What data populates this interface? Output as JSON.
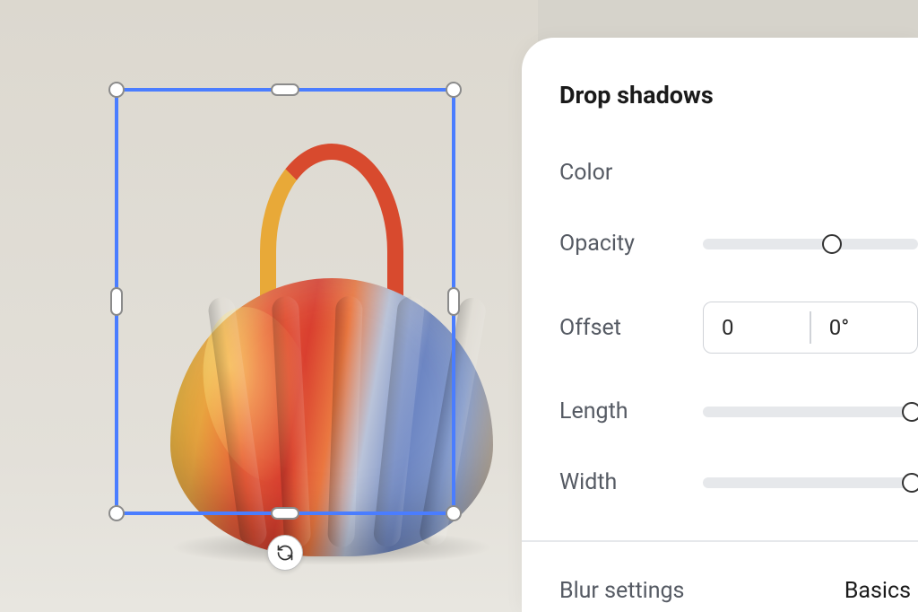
{
  "panel": {
    "title": "Drop shadows",
    "controls": {
      "color": {
        "label": "Color"
      },
      "opacity": {
        "label": "Opacity",
        "value_pct": 60
      },
      "offset": {
        "label": "Offset",
        "distance": "0",
        "angle": "0°"
      },
      "length": {
        "label": "Length",
        "value_pct": 100
      },
      "width": {
        "label": "Width",
        "value_pct": 100
      }
    },
    "blur": {
      "label": "Blur settings",
      "mode": "Basics"
    }
  },
  "selection": {
    "rotate_tooltip": "Rotate"
  }
}
